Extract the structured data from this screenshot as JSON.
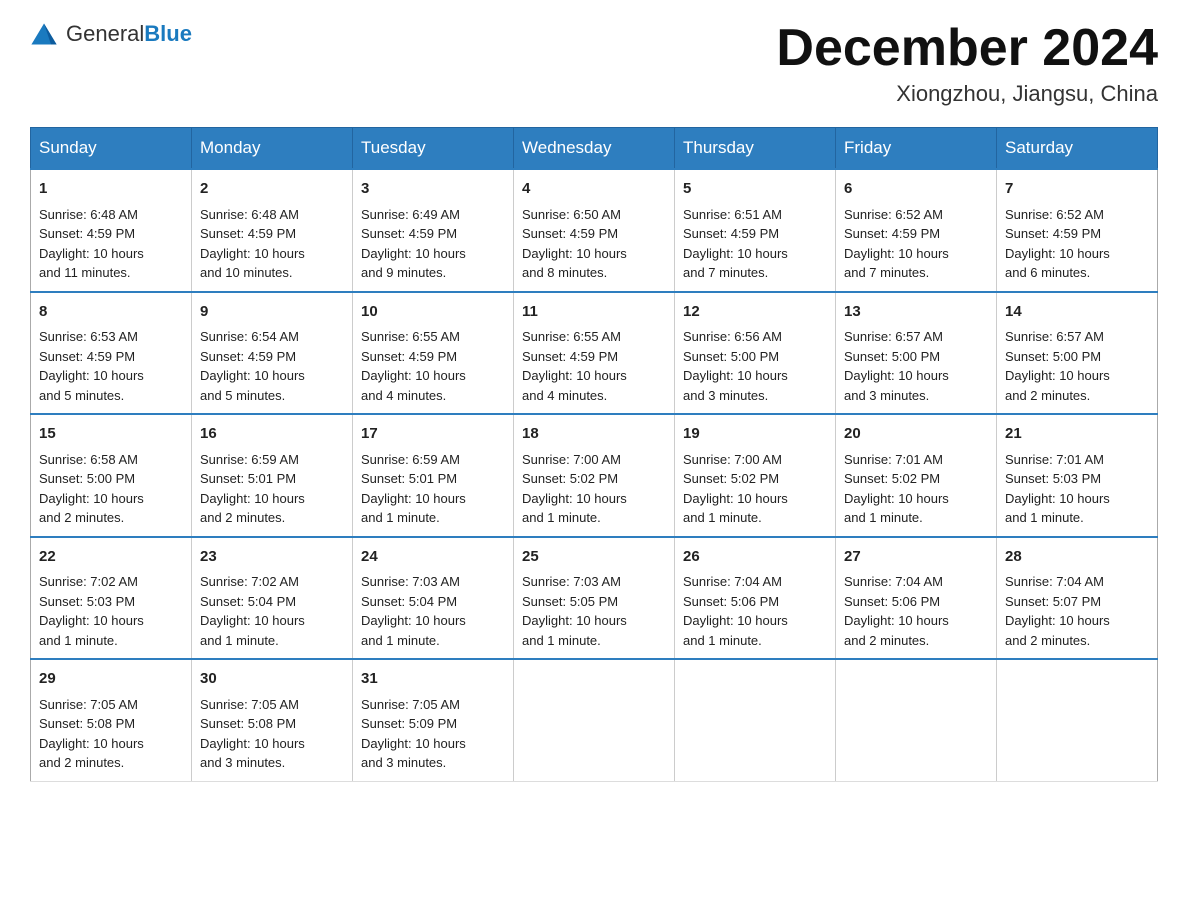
{
  "logo": {
    "text_general": "General",
    "text_blue": "Blue"
  },
  "title": "December 2024",
  "subtitle": "Xiongzhou, Jiangsu, China",
  "days_of_week": [
    "Sunday",
    "Monday",
    "Tuesday",
    "Wednesday",
    "Thursday",
    "Friday",
    "Saturday"
  ],
  "weeks": [
    [
      {
        "day": "1",
        "sunrise": "6:48 AM",
        "sunset": "4:59 PM",
        "daylight": "10 hours and 11 minutes."
      },
      {
        "day": "2",
        "sunrise": "6:48 AM",
        "sunset": "4:59 PM",
        "daylight": "10 hours and 10 minutes."
      },
      {
        "day": "3",
        "sunrise": "6:49 AM",
        "sunset": "4:59 PM",
        "daylight": "10 hours and 9 minutes."
      },
      {
        "day": "4",
        "sunrise": "6:50 AM",
        "sunset": "4:59 PM",
        "daylight": "10 hours and 8 minutes."
      },
      {
        "day": "5",
        "sunrise": "6:51 AM",
        "sunset": "4:59 PM",
        "daylight": "10 hours and 7 minutes."
      },
      {
        "day": "6",
        "sunrise": "6:52 AM",
        "sunset": "4:59 PM",
        "daylight": "10 hours and 7 minutes."
      },
      {
        "day": "7",
        "sunrise": "6:52 AM",
        "sunset": "4:59 PM",
        "daylight": "10 hours and 6 minutes."
      }
    ],
    [
      {
        "day": "8",
        "sunrise": "6:53 AM",
        "sunset": "4:59 PM",
        "daylight": "10 hours and 5 minutes."
      },
      {
        "day": "9",
        "sunrise": "6:54 AM",
        "sunset": "4:59 PM",
        "daylight": "10 hours and 5 minutes."
      },
      {
        "day": "10",
        "sunrise": "6:55 AM",
        "sunset": "4:59 PM",
        "daylight": "10 hours and 4 minutes."
      },
      {
        "day": "11",
        "sunrise": "6:55 AM",
        "sunset": "4:59 PM",
        "daylight": "10 hours and 4 minutes."
      },
      {
        "day": "12",
        "sunrise": "6:56 AM",
        "sunset": "5:00 PM",
        "daylight": "10 hours and 3 minutes."
      },
      {
        "day": "13",
        "sunrise": "6:57 AM",
        "sunset": "5:00 PM",
        "daylight": "10 hours and 3 minutes."
      },
      {
        "day": "14",
        "sunrise": "6:57 AM",
        "sunset": "5:00 PM",
        "daylight": "10 hours and 2 minutes."
      }
    ],
    [
      {
        "day": "15",
        "sunrise": "6:58 AM",
        "sunset": "5:00 PM",
        "daylight": "10 hours and 2 minutes."
      },
      {
        "day": "16",
        "sunrise": "6:59 AM",
        "sunset": "5:01 PM",
        "daylight": "10 hours and 2 minutes."
      },
      {
        "day": "17",
        "sunrise": "6:59 AM",
        "sunset": "5:01 PM",
        "daylight": "10 hours and 1 minute."
      },
      {
        "day": "18",
        "sunrise": "7:00 AM",
        "sunset": "5:02 PM",
        "daylight": "10 hours and 1 minute."
      },
      {
        "day": "19",
        "sunrise": "7:00 AM",
        "sunset": "5:02 PM",
        "daylight": "10 hours and 1 minute."
      },
      {
        "day": "20",
        "sunrise": "7:01 AM",
        "sunset": "5:02 PM",
        "daylight": "10 hours and 1 minute."
      },
      {
        "day": "21",
        "sunrise": "7:01 AM",
        "sunset": "5:03 PM",
        "daylight": "10 hours and 1 minute."
      }
    ],
    [
      {
        "day": "22",
        "sunrise": "7:02 AM",
        "sunset": "5:03 PM",
        "daylight": "10 hours and 1 minute."
      },
      {
        "day": "23",
        "sunrise": "7:02 AM",
        "sunset": "5:04 PM",
        "daylight": "10 hours and 1 minute."
      },
      {
        "day": "24",
        "sunrise": "7:03 AM",
        "sunset": "5:04 PM",
        "daylight": "10 hours and 1 minute."
      },
      {
        "day": "25",
        "sunrise": "7:03 AM",
        "sunset": "5:05 PM",
        "daylight": "10 hours and 1 minute."
      },
      {
        "day": "26",
        "sunrise": "7:04 AM",
        "sunset": "5:06 PM",
        "daylight": "10 hours and 1 minute."
      },
      {
        "day": "27",
        "sunrise": "7:04 AM",
        "sunset": "5:06 PM",
        "daylight": "10 hours and 2 minutes."
      },
      {
        "day": "28",
        "sunrise": "7:04 AM",
        "sunset": "5:07 PM",
        "daylight": "10 hours and 2 minutes."
      }
    ],
    [
      {
        "day": "29",
        "sunrise": "7:05 AM",
        "sunset": "5:08 PM",
        "daylight": "10 hours and 2 minutes."
      },
      {
        "day": "30",
        "sunrise": "7:05 AM",
        "sunset": "5:08 PM",
        "daylight": "10 hours and 3 minutes."
      },
      {
        "day": "31",
        "sunrise": "7:05 AM",
        "sunset": "5:09 PM",
        "daylight": "10 hours and 3 minutes."
      },
      null,
      null,
      null,
      null
    ]
  ],
  "labels": {
    "sunrise": "Sunrise:",
    "sunset": "Sunset:",
    "daylight": "Daylight:"
  }
}
